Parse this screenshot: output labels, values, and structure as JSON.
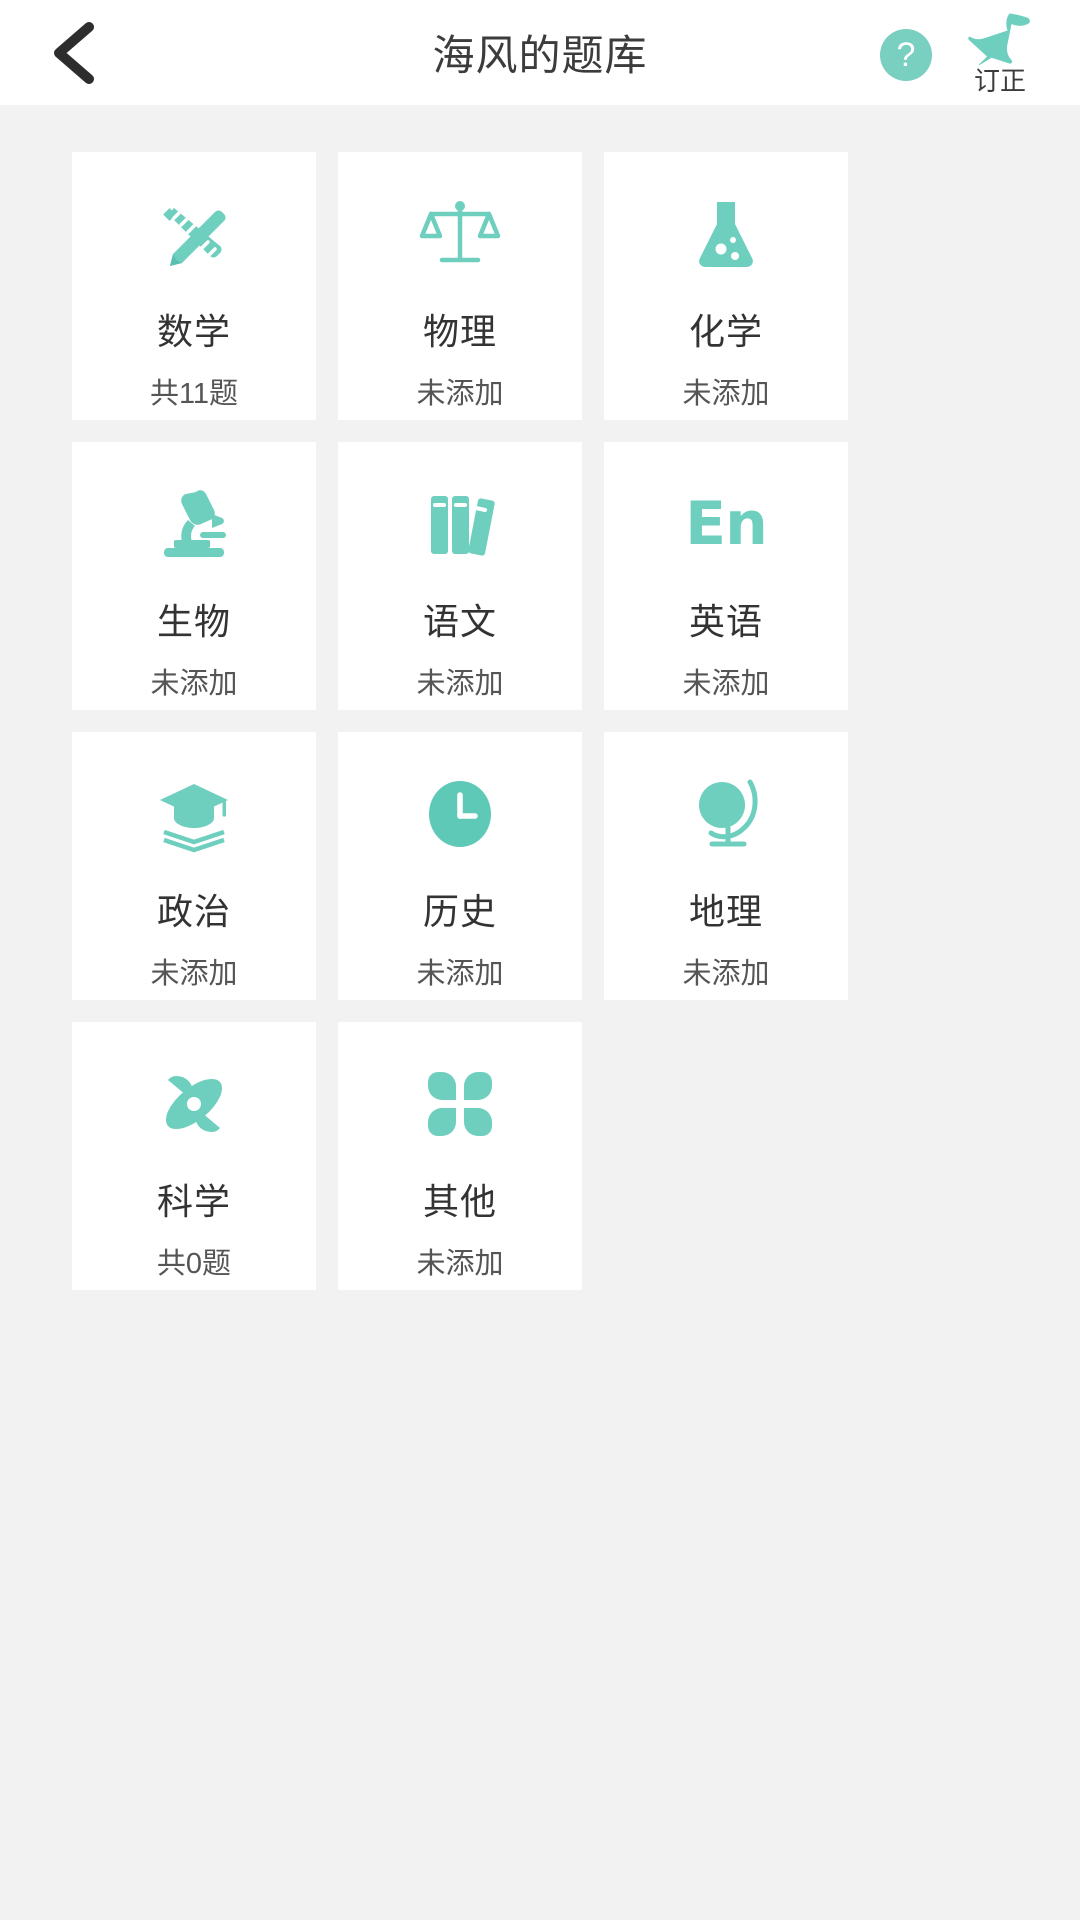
{
  "header": {
    "title": "海风的题库",
    "back_icon": "chevron-left-icon",
    "help_icon": "question-mark-icon",
    "help_label": "?",
    "pin_icon": "pin-icon",
    "pin_label": "订正"
  },
  "theme": {
    "accent": "#6ecfbf",
    "accent_dark": "#4fbfa8",
    "page_bg": "#f2f2f2",
    "card_bg": "#ffffff",
    "title_color": "#333333",
    "sub_color": "#555555"
  },
  "subjects": [
    {
      "title": "数学",
      "sub": "共11题",
      "icon": "pencil-ruler-icon"
    },
    {
      "title": "物理",
      "sub": "未添加",
      "icon": "balance-scale-icon"
    },
    {
      "title": "化学",
      "sub": "未添加",
      "icon": "flask-icon"
    },
    {
      "title": "生物",
      "sub": "未添加",
      "icon": "microscope-icon"
    },
    {
      "title": "语文",
      "sub": "未添加",
      "icon": "books-icon"
    },
    {
      "title": "英语",
      "sub": "未添加",
      "icon": "en-text-icon"
    },
    {
      "title": "政治",
      "sub": "未添加",
      "icon": "graduation-cap-book-icon"
    },
    {
      "title": "历史",
      "sub": "未添加",
      "icon": "clock-icon"
    },
    {
      "title": "地理",
      "sub": "未添加",
      "icon": "globe-icon"
    },
    {
      "title": "科学",
      "sub": "共0题",
      "icon": "atom-icon"
    },
    {
      "title": "其他",
      "sub": "未添加",
      "icon": "four-petals-icon"
    }
  ]
}
